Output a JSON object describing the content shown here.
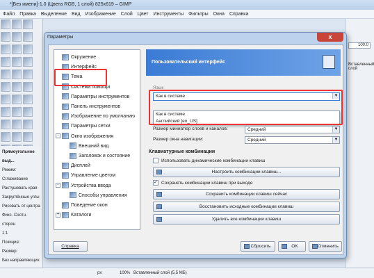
{
  "gimp": {
    "title": "*[Без имени]-1.0 (Цвета RGB, 1 слой) 825x619 – GIMP",
    "menu": [
      "Файл",
      "Правка",
      "Выделение",
      "Вид",
      "Изображение",
      "Слой",
      "Цвет",
      "Инструменты",
      "Фильтры",
      "Окна",
      "Справка"
    ],
    "tool_options": {
      "title": "Прямоугольное выд...",
      "mode_label": "Режим:",
      "items": [
        "Сглаживание",
        "Растушевать края",
        "Закруглённые углы",
        "Рисовать от центра",
        "Фикс. Соотн. сторон",
        "1:1",
        "Позиция:",
        "Размер:",
        "Без направляющих"
      ]
    },
    "right_dock": {
      "value": "100.0",
      "label": "Вставленный слой"
    },
    "status": {
      "unit": "px",
      "zoom": "100%",
      "info": "Вставленный слой (5,5 МБ)"
    }
  },
  "dialog": {
    "title": "Параметры",
    "close": "x",
    "tree": [
      {
        "label": "Окружение",
        "level": 1
      },
      {
        "label": "Интерфейс",
        "level": 1
      },
      {
        "label": "Тема",
        "level": 1
      },
      {
        "label": "Система помощи",
        "level": 1
      },
      {
        "label": "Параметры инструментов",
        "level": 1
      },
      {
        "label": "Панель инструментов",
        "level": 1
      },
      {
        "label": "Изображение по умолчанию",
        "level": 1
      },
      {
        "label": "Параметры сетки",
        "level": 1
      },
      {
        "label": "Окно изображения",
        "level": 1,
        "toggle": "-"
      },
      {
        "label": "Внешний вид",
        "level": 2
      },
      {
        "label": "Заголовок и состояние",
        "level": 2
      },
      {
        "label": "Дисплей",
        "level": 1
      },
      {
        "label": "Управление цветом",
        "level": 1
      },
      {
        "label": "Устройства ввода",
        "level": 1,
        "toggle": "-"
      },
      {
        "label": "Способы управления",
        "level": 2
      },
      {
        "label": "Поведение окон",
        "level": 1
      },
      {
        "label": "Каталоги",
        "level": 1,
        "toggle": "+"
      }
    ],
    "banner": "Пользовательский интерфейс",
    "language": {
      "section": "Язык",
      "selected": "Как в системе",
      "options": [
        "Как в системе",
        "Английский [en_US]"
      ]
    },
    "preview": {
      "layer_size_label": "Размер миниатюр слоев и каналов:",
      "layer_size_value": "Средний",
      "nav_size_label": "Размер окна навигации:",
      "nav_size_value": "Средний"
    },
    "shortcuts": {
      "section": "Клавиатурные комбинации",
      "dynamic_label": "Использовать динамические комбинации клавиш",
      "configure_button": "Настроить комбинации клавиш...",
      "save_on_exit_label": "Сохранять комбинации клавиш при выходе",
      "save_now_button": "Сохранить комбинации клавиш сейчас",
      "restore_button": "Восстановить исходные комбинации клавиш",
      "delete_button": "Удалить все комбинации клавиш"
    },
    "buttons": {
      "help": "Справка",
      "reset": "Сбросить",
      "ok": "OK",
      "cancel": "Отменить"
    }
  }
}
